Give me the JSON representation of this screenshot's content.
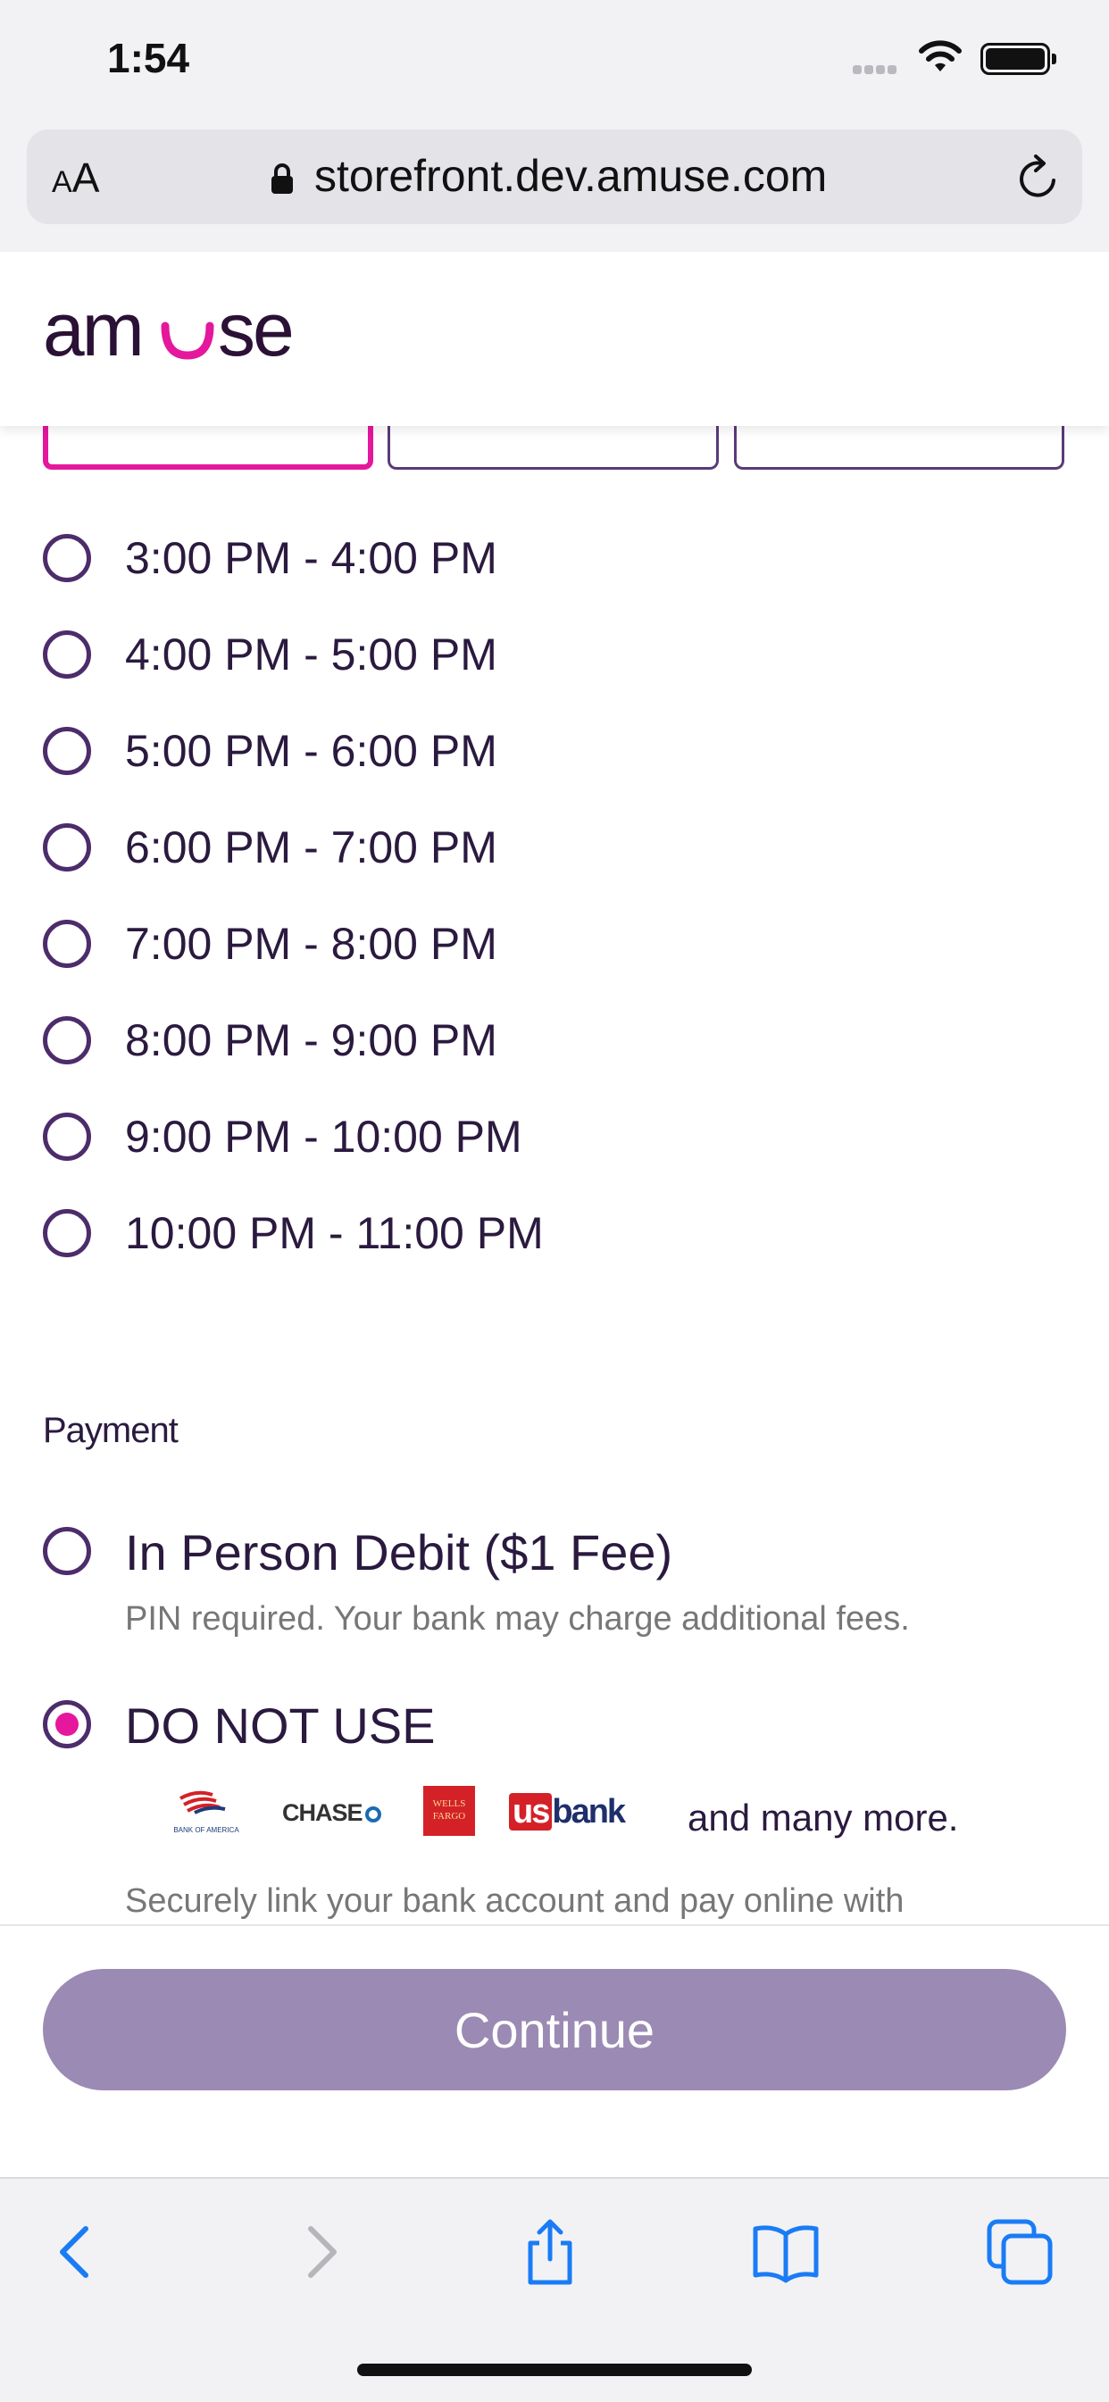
{
  "status_bar": {
    "time": "1:54"
  },
  "browser": {
    "text_size_label": "AA",
    "url": "storefront.dev.amuse.com"
  },
  "brand": {
    "logo_text": "amuse",
    "accent": "#e5179d",
    "primary": "#4d2c6b"
  },
  "time_slots": [
    {
      "label": "3:00 PM - 4:00 PM"
    },
    {
      "label": "4:00 PM - 5:00 PM"
    },
    {
      "label": "5:00 PM - 6:00 PM"
    },
    {
      "label": "6:00 PM - 7:00 PM"
    },
    {
      "label": "7:00 PM - 8:00 PM"
    },
    {
      "label": "8:00 PM - 9:00 PM"
    },
    {
      "label": "9:00 PM - 10:00 PM"
    },
    {
      "label": "10:00 PM - 11:00 PM"
    }
  ],
  "payment": {
    "heading": "Payment",
    "options": [
      {
        "label": "In Person Debit ($1 Fee)",
        "description": "PIN required. Your bank may charge additional fees.",
        "selected": false
      },
      {
        "label": "DO NOT USE",
        "selected": true
      }
    ],
    "banks": {
      "boa": "BANK OF AMERICA",
      "chase": "CHASE",
      "wells": "WELLS FARGO",
      "usbank_us": "us",
      "usbank_bank": "bank"
    },
    "banks_suffix": "and many more.",
    "link_description": "Securely link your bank account and pay online with"
  },
  "continue_label": "Continue",
  "toolbar_icons": [
    "back-icon",
    "forward-icon",
    "share-icon",
    "bookmarks-icon",
    "tabs-icon"
  ]
}
